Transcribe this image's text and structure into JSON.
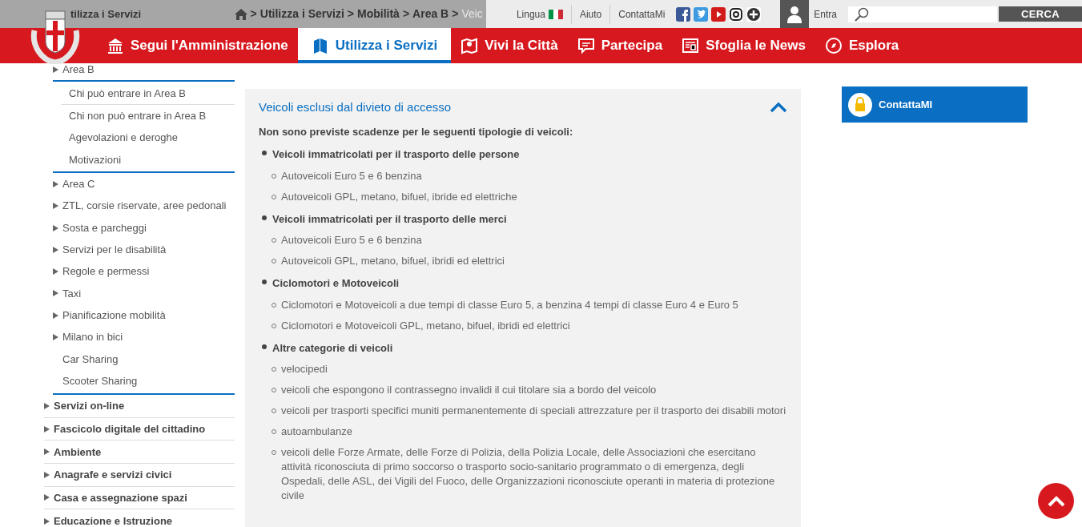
{
  "topbar": {
    "section_label": "tilizza i Servizi",
    "breadcrumb": [
      "Utilizza i Servizi",
      "Mobilità",
      "Area B"
    ],
    "separator": ">",
    "breadcrumb_faded": "Veic",
    "links": [
      "Lingua",
      "Aiuto",
      "ContattaMi"
    ],
    "login": "Entra",
    "search": {
      "button": "CERCA"
    }
  },
  "nav": [
    {
      "label": "Segui l'Amministrazione",
      "selected": false
    },
    {
      "label": "Utilizza i Servizi",
      "selected": true
    },
    {
      "label": "Vivi la Città",
      "selected": false
    },
    {
      "label": "Partecipa",
      "selected": false
    },
    {
      "label": "Sfoglia le News",
      "selected": false
    },
    {
      "label": "Esplora",
      "selected": false
    }
  ],
  "sidebar": {
    "items": [
      {
        "label": "Area B",
        "has_children": true,
        "children": [
          {
            "label": "Chi può entrare in Area B"
          },
          {
            "label": "Chi non può entrare in Area B"
          },
          {
            "label": "Agevolazioni e deroghe"
          },
          {
            "label": "Motivazioni"
          }
        ]
      },
      {
        "label": "Area C",
        "has_children": true
      },
      {
        "label": "ZTL, corsie riservate, aree pedonali",
        "has_children": true
      },
      {
        "label": "Sosta e parcheggi",
        "has_children": true
      },
      {
        "label": "Servizi per le disabilità",
        "has_children": true
      },
      {
        "label": "Regole e permessi",
        "has_children": true
      },
      {
        "label": "Taxi",
        "has_children": true
      },
      {
        "label": "Pianificazione mobilità",
        "has_children": true
      },
      {
        "label": "Milano in bici",
        "has_children": true
      },
      {
        "label": "Car Sharing",
        "has_children": false
      },
      {
        "label": "Scooter Sharing",
        "has_children": false
      }
    ],
    "sections": [
      {
        "label": "Servizi on-line"
      },
      {
        "label": "Fascicolo digitale del cittadino"
      },
      {
        "label": "Ambiente"
      },
      {
        "label": "Anagrafe e servizi civici"
      },
      {
        "label": "Casa e assegnazione spazi"
      },
      {
        "label": "Educazione e Istruzione"
      }
    ]
  },
  "accordion": {
    "title": "Veicoli esclusi dal divieto di accesso",
    "expanded": true,
    "intro": "Non sono previste scadenze per le seguenti tipologie di veicoli:",
    "groups": [
      {
        "label": "Veicoli immatricolati per il trasporto delle persone",
        "items": [
          "Autoveicoli Euro 5 e 6 benzina",
          "Autoveicoli GPL, metano, bifuel, ibride ed elettriche"
        ]
      },
      {
        "label": "Veicoli immatricolati per il trasporto delle merci",
        "items": [
          "Autoveicoli Euro 5 e 6 benzina",
          "Autoveicoli GPL, metano, bifuel, ibridi ed elettrici"
        ]
      },
      {
        "label": "Ciclomotori e Motoveicoli",
        "items": [
          "Ciclomotori e Motoveicoli a due tempi di classe Euro 5, a benzina 4 tempi di classe Euro 4 e Euro 5",
          "Ciclomotori e Motoveicoli GPL, metano, bifuel, ibridi ed elettrici"
        ]
      },
      {
        "label": "Altre categorie di veicoli",
        "items": [
          "velocipedi",
          "veicoli che espongono il contrassegno invalidi il cui titolare sia a bordo del veicolo",
          "veicoli per trasporti specifici muniti permanentemente di speciali attrezzature per il trasporto dei disabili motori",
          "autoambulanze",
          "veicoli delle Forze Armate, delle Forze di Polizia, della Polizia Locale, delle Associazioni che esercitano attività riconosciuta di primo soccorso o trasporto socio-sanitario programmato o di emergenza, degli Ospedali, delle ASL, dei Vigili del Fuoco, delle Organizzazioni riconosciute operanti in materia di protezione civile"
        ]
      }
    ]
  },
  "contact_box": {
    "label": "ContattaMI"
  }
}
